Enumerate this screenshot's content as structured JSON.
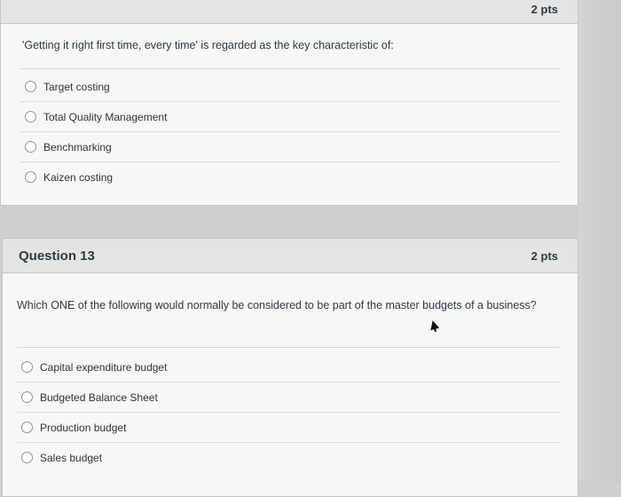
{
  "question12": {
    "points": "2 pts",
    "text": "'Getting it right first time, every time' is regarded as the key characteristic of:",
    "answers": [
      "Target costing",
      "Total Quality Management",
      "Benchmarking",
      "Kaizen costing"
    ]
  },
  "question13": {
    "title": "Question 13",
    "points": "2 pts",
    "text": "Which ONE of the following would normally be considered to be part of the master budgets of a business?",
    "answers": [
      "Capital expenditure budget",
      "Budgeted Balance Sheet",
      "Production budget",
      "Sales budget"
    ]
  },
  "colors": {
    "background": "#cfcfcd",
    "card": "#f7f7f5",
    "header": "#e4e5e3",
    "text": "#2d3b45"
  }
}
